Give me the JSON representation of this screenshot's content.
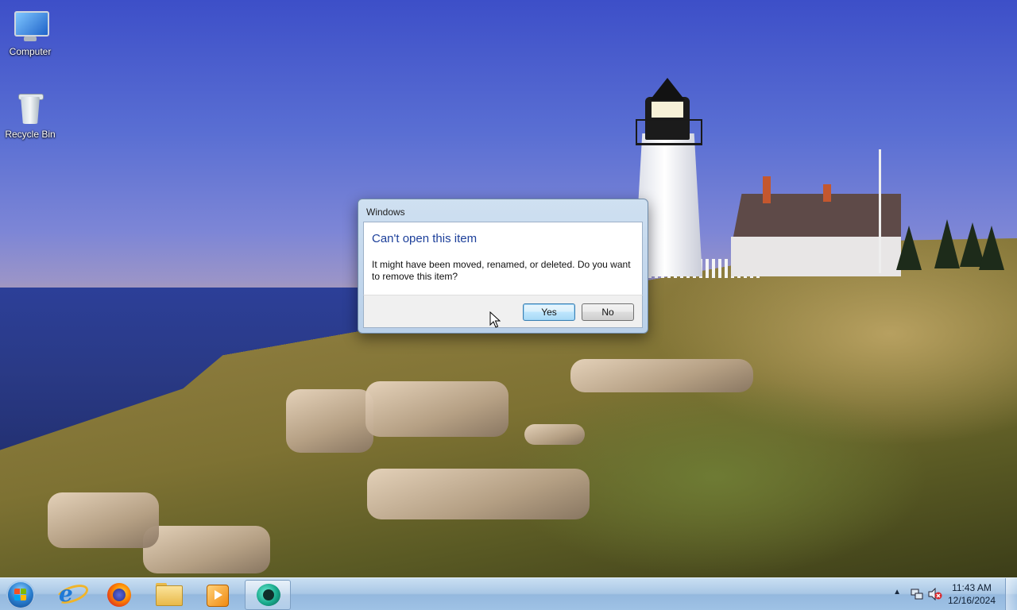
{
  "desktop": {
    "icons": [
      {
        "label": "Computer",
        "icon": "computer-icon"
      },
      {
        "label": "Recycle Bin",
        "icon": "recycle-bin-icon"
      }
    ]
  },
  "dialog": {
    "title": "Windows",
    "heading": "Can't open this item",
    "message": "It might have been moved, renamed, or deleted. Do you want to remove this item?",
    "yes_label": "Yes",
    "no_label": "No",
    "accent": "#1c3f9a"
  },
  "taskbar": {
    "pinned": [
      {
        "name": "internet-explorer",
        "icon": "internet-explorer-icon"
      },
      {
        "name": "firefox",
        "icon": "firefox-icon"
      },
      {
        "name": "windows-explorer",
        "icon": "folder-icon"
      },
      {
        "name": "media-player",
        "icon": "media-player-icon"
      },
      {
        "name": "active-app",
        "icon": "app-icon",
        "active": true
      }
    ],
    "tray": {
      "time": "11:43 AM",
      "date": "12/16/2024",
      "icons": [
        "show-hidden-icons-arrow",
        "network-icon",
        "volume-muted-icon"
      ]
    }
  }
}
